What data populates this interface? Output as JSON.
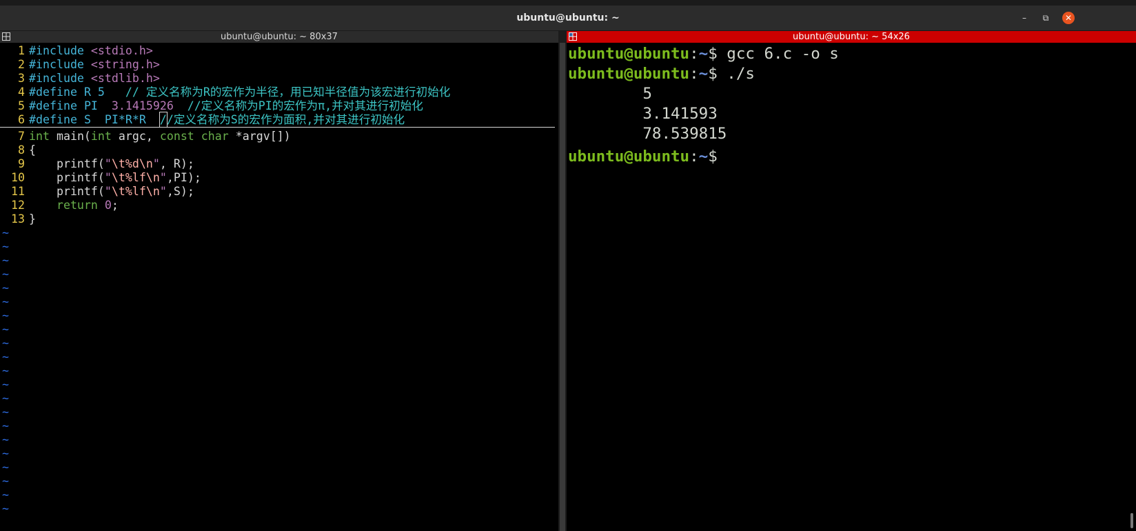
{
  "window": {
    "title": "ubuntu@ubuntu: ~",
    "minimize": "–",
    "maximize": "⧉",
    "close": "✕"
  },
  "left_pane": {
    "title": "ubuntu@ubuntu: ~ 80x37",
    "code_lines": [
      {
        "n": "1"
      },
      {
        "n": "2"
      },
      {
        "n": "3"
      },
      {
        "n": "4"
      },
      {
        "n": "5"
      },
      {
        "n": "6"
      },
      {
        "n": "7"
      },
      {
        "n": "8"
      },
      {
        "n": "9"
      },
      {
        "n": "10"
      },
      {
        "n": "11"
      },
      {
        "n": "12"
      },
      {
        "n": "13"
      }
    ],
    "src": {
      "l1a": "#include ",
      "l1b": "<stdio.h>",
      "l2a": "#include ",
      "l2b": "<string.h>",
      "l3a": "#include ",
      "l3b": "<stdlib.h>",
      "l4a": "#define ",
      "l4b": "R 5   ",
      "l4c": "// 定义名称为R的宏作为半径，用已知半径值为该宏进行初始化",
      "l5a": "#define ",
      "l5b": "PI  ",
      "l5c": "3.1415926",
      "l5d": "  //定义名称为PI的宏作为π,并对其进行初始化",
      "l6a": "#define ",
      "l6b": "S  PI*R*R  ",
      "l6c": "/",
      "l6d": "/定义名称为S的宏作为面积,并对其进行初始化",
      "l7a": "int ",
      "l7b": "main(",
      "l7c": "int ",
      "l7d": "argc, ",
      "l7e": "const char ",
      "l7f": "*argv[])",
      "l8": "{",
      "l9a": "    printf(",
      "l9b": "\"",
      "l9c": "\\t",
      "l9d": "%d",
      "l9e": "\\n",
      "l9f": "\"",
      "l9g": ", R);",
      "l10a": "    printf(",
      "l10b": "\"",
      "l10c": "\\t",
      "l10d": "%lf",
      "l10e": "\\n",
      "l10f": "\"",
      "l10g": ",PI);",
      "l11a": "    printf(",
      "l11b": "\"",
      "l11c": "\\t",
      "l11d": "%lf",
      "l11e": "\\n",
      "l11f": "\"",
      "l11g": ",S);",
      "l12a": "    return ",
      "l12b": "0",
      "l12c": ";",
      "l13": "}"
    },
    "tilde": "~"
  },
  "right_pane": {
    "title": "ubuntu@ubuntu: ~ 54x26",
    "prompt_user": "ubuntu@ubuntu",
    "prompt_sep": ":",
    "prompt_path": "~",
    "prompt_dollar": "$ ",
    "cmd1": "gcc 6.c -o s",
    "cmd2": "./s",
    "out1": "        5",
    "out2": "        3.141593",
    "out3": "        78.539815"
  }
}
